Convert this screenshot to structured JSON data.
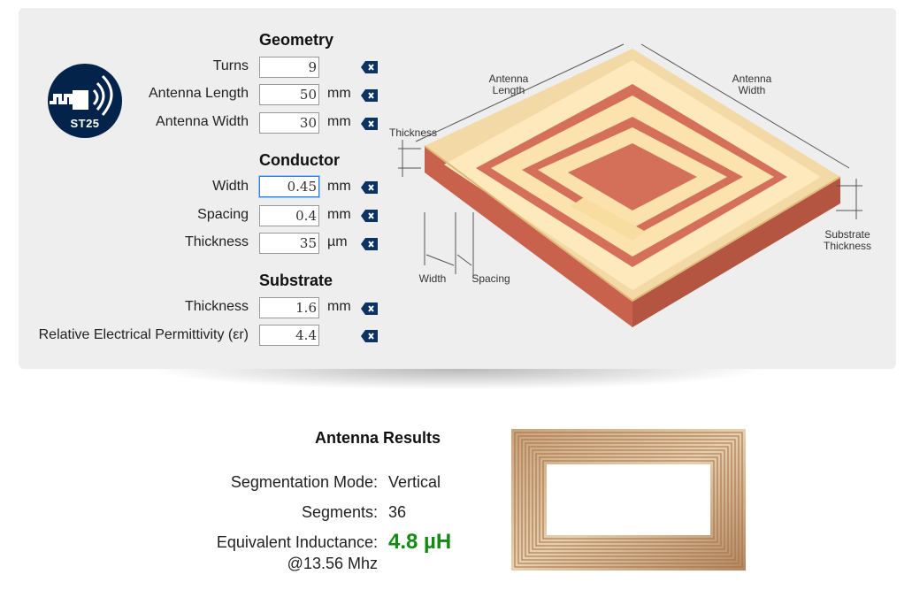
{
  "logo": {
    "text": "ST25",
    "icon": "nfc-antenna-icon"
  },
  "geometry": {
    "title": "Geometry",
    "turns": {
      "label": "Turns",
      "value": "9",
      "unit": ""
    },
    "length": {
      "label": "Antenna Length",
      "value": "50",
      "unit": "mm"
    },
    "width": {
      "label": "Antenna Width",
      "value": "30",
      "unit": "mm"
    }
  },
  "conductor": {
    "title": "Conductor",
    "width": {
      "label": "Width",
      "value": "0.45",
      "unit": "mm"
    },
    "spacing": {
      "label": "Spacing",
      "value": "0.4",
      "unit": "mm"
    },
    "thickness": {
      "label": "Thickness",
      "value": "35",
      "unit": "µm"
    }
  },
  "substrate": {
    "title": "Substrate",
    "thickness": {
      "label": "Thickness",
      "value": "1.6",
      "unit": "mm"
    },
    "permittivity": {
      "label": "Relative Electrical Permittivity (εr)",
      "value": "4.4",
      "unit": ""
    }
  },
  "diagram": {
    "antenna_length": "Antenna\nLength",
    "antenna_width": "Antenna\nWidth",
    "thickness": "Thickness",
    "substrate_thickness": "Substrate\nThickness",
    "width": "Width",
    "spacing": "Spacing"
  },
  "results": {
    "title": "Antenna Results",
    "segmentation_label": "Segmentation Mode:",
    "segmentation_value": "Vertical",
    "segments_label": "Segments:",
    "segments_value": "36",
    "inductance_label": "Equivalent Inductance:",
    "inductance_sub": "@13.56 Mhz",
    "inductance_value": "4.8 µH"
  },
  "colors": {
    "accent_green": "#138a13",
    "logo_navy": "#03234b",
    "copper": "#d4705a",
    "pad": "#fbe3ad"
  }
}
